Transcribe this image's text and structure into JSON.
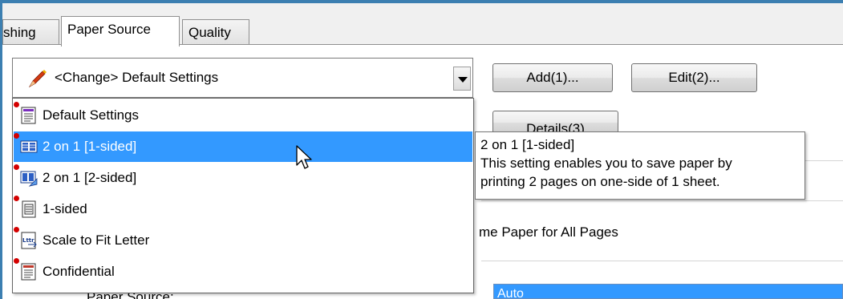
{
  "tabs": [
    {
      "label": "shing",
      "selected": false
    },
    {
      "label": "Paper Source",
      "selected": true
    },
    {
      "label": "Quality",
      "selected": false
    }
  ],
  "profile_combo": {
    "value": "<Change> Default Settings",
    "icon": "pencil-icon"
  },
  "buttons": {
    "add": "Add(1)...",
    "edit": "Edit(2)...",
    "details": "Details(3)"
  },
  "profiles": [
    {
      "label": "Default Settings",
      "icon": "default-settings-icon",
      "highlighted": false
    },
    {
      "label": "2 on 1 [1-sided]",
      "icon": "two-on-one-icon",
      "highlighted": true
    },
    {
      "label": "2 on 1 [2-sided]",
      "icon": "two-on-one-duplex-icon",
      "highlighted": false
    },
    {
      "label": "1-sided",
      "icon": "one-sided-icon",
      "highlighted": false
    },
    {
      "label": "Scale to Fit Letter",
      "icon": "scale-letter-icon",
      "highlighted": false
    },
    {
      "label": "Confidential",
      "icon": "confidential-icon",
      "highlighted": false
    }
  ],
  "tooltip": {
    "title": "2 on 1 [1-sided]",
    "line1": "This setting enables you to save paper by",
    "line2": "printing 2 pages on one-side of 1 sheet."
  },
  "background": {
    "same_paper": "me Paper for All Pages",
    "paper_source_label": "Paper Source:",
    "paper_source_value": "Auto"
  },
  "colors": {
    "highlight": "#3399ff",
    "window_frame": "#3c7fb1"
  }
}
